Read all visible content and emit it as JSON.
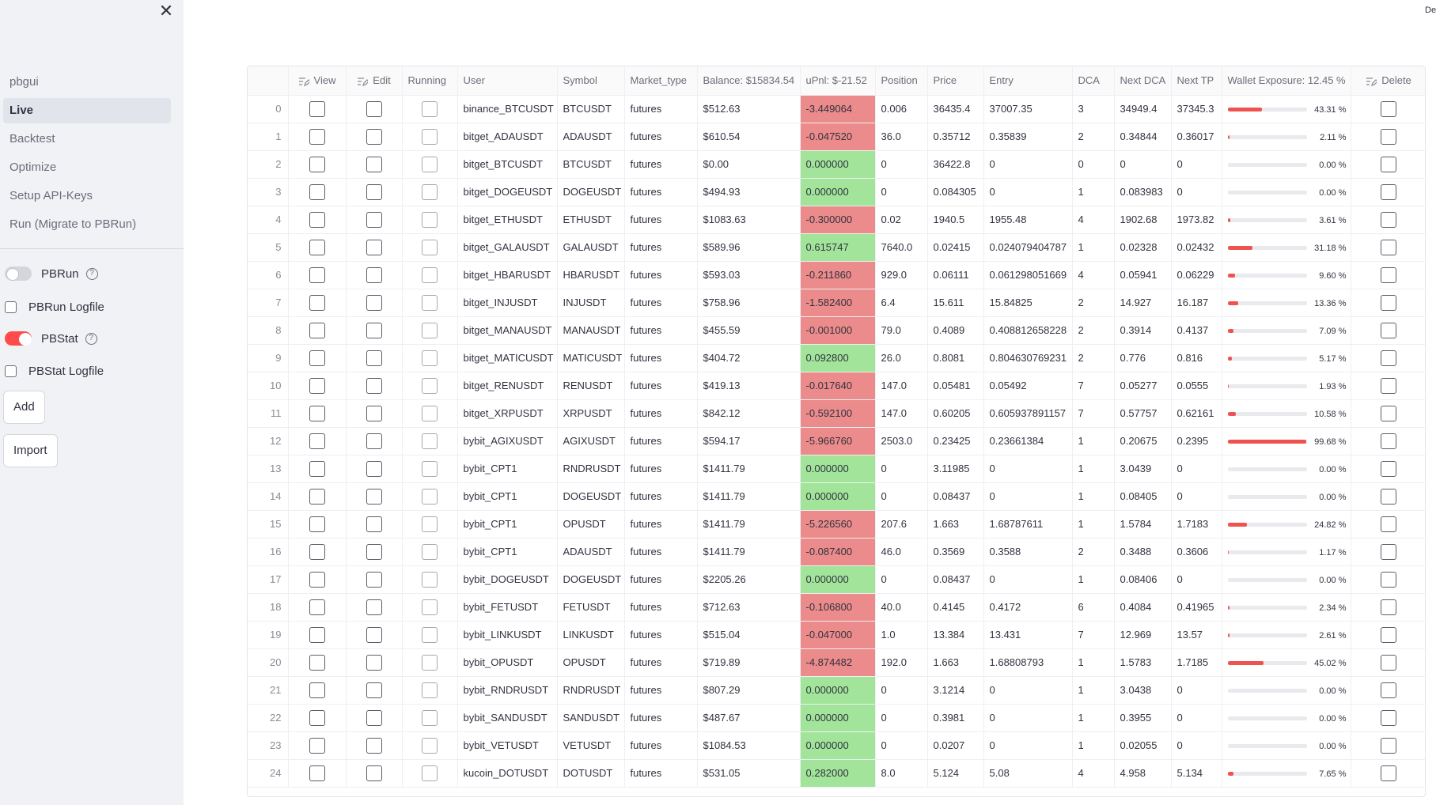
{
  "app": {
    "topright_text": "Deploy"
  },
  "sidebar": {
    "close_icon": "✕",
    "nav": [
      {
        "label": "pbgui",
        "active": false
      },
      {
        "label": "Live",
        "active": true
      },
      {
        "label": "Backtest",
        "active": false
      },
      {
        "label": "Optimize",
        "active": false
      },
      {
        "label": "Setup API-Keys",
        "active": false
      },
      {
        "label": "Run (Migrate to PBRun)",
        "active": false
      }
    ],
    "pbrun_toggle": {
      "label": "PBRun",
      "on": false
    },
    "pbrun_logfile": {
      "label": "PBRun Logfile",
      "checked": false
    },
    "pbstat_toggle": {
      "label": "PBStat",
      "on": true
    },
    "pbstat_logfile": {
      "label": "PBStat Logfile",
      "checked": false
    },
    "add_button": "Add",
    "import_button": "Import",
    "help_glyph": "?"
  },
  "table": {
    "columns": [
      "",
      "View",
      "Edit",
      "Running",
      "User",
      "Symbol",
      "Market_type",
      "Balance: $15834.54",
      "uPnl: $-21.52",
      "Position",
      "Price",
      "Entry",
      "DCA",
      "Next DCA",
      "Next TP",
      "Wallet Exposure: 12.45 %",
      "Delete"
    ],
    "colors": {
      "negative": "#ec8b8b",
      "positive": "#a2e59a",
      "bar": "#ef5350"
    },
    "rows": [
      {
        "idx": "0",
        "user": "binance_BTCUSDT",
        "symbol": "BTCUSDT",
        "market": "futures",
        "balance": "$512.63",
        "upnl": "-3.449064",
        "position": "0.006",
        "price": "36435.4",
        "entry": "37007.35",
        "dca": "3",
        "next_dca": "34949.4",
        "next_tp": "37345.3",
        "we": "43.31 %",
        "we_frac": 0.4331
      },
      {
        "idx": "1",
        "user": "bitget_ADAUSDT",
        "symbol": "ADAUSDT",
        "market": "futures",
        "balance": "$610.54",
        "upnl": "-0.047520",
        "position": "36.0",
        "price": "0.35712",
        "entry": "0.35839",
        "dca": "2",
        "next_dca": "0.34844",
        "next_tp": "0.36017",
        "we": "2.11 %",
        "we_frac": 0.0211
      },
      {
        "idx": "2",
        "user": "bitget_BTCUSDT",
        "symbol": "BTCUSDT",
        "market": "futures",
        "balance": "$0.00",
        "upnl": "0.000000",
        "position": "0",
        "price": "36422.8",
        "entry": "0",
        "dca": "0",
        "next_dca": "0",
        "next_tp": "0",
        "we": "0.00 %",
        "we_frac": 0
      },
      {
        "idx": "3",
        "user": "bitget_DOGEUSDT",
        "symbol": "DOGEUSDT",
        "market": "futures",
        "balance": "$494.93",
        "upnl": "0.000000",
        "position": "0",
        "price": "0.084305",
        "entry": "0",
        "dca": "1",
        "next_dca": "0.083983",
        "next_tp": "0",
        "we": "0.00 %",
        "we_frac": 0
      },
      {
        "idx": "4",
        "user": "bitget_ETHUSDT",
        "symbol": "ETHUSDT",
        "market": "futures",
        "balance": "$1083.63",
        "upnl": "-0.300000",
        "position": "0.02",
        "price": "1940.5",
        "entry": "1955.48",
        "dca": "4",
        "next_dca": "1902.68",
        "next_tp": "1973.82",
        "we": "3.61 %",
        "we_frac": 0.0361
      },
      {
        "idx": "5",
        "user": "bitget_GALAUSDT",
        "symbol": "GALAUSDT",
        "market": "futures",
        "balance": "$589.96",
        "upnl": "0.615747",
        "position": "7640.0",
        "price": "0.02415",
        "entry": "0.024079404787",
        "dca": "1",
        "next_dca": "0.02328",
        "next_tp": "0.02432",
        "we": "31.18 %",
        "we_frac": 0.3118
      },
      {
        "idx": "6",
        "user": "bitget_HBARUSDT",
        "symbol": "HBARUSDT",
        "market": "futures",
        "balance": "$593.03",
        "upnl": "-0.211860",
        "position": "929.0",
        "price": "0.06111",
        "entry": "0.061298051669",
        "dca": "4",
        "next_dca": "0.05941",
        "next_tp": "0.06229",
        "we": "9.60 %",
        "we_frac": 0.096
      },
      {
        "idx": "7",
        "user": "bitget_INJUSDT",
        "symbol": "INJUSDT",
        "market": "futures",
        "balance": "$758.96",
        "upnl": "-1.582400",
        "position": "6.4",
        "price": "15.611",
        "entry": "15.84825",
        "dca": "2",
        "next_dca": "14.927",
        "next_tp": "16.187",
        "we": "13.36 %",
        "we_frac": 0.1336
      },
      {
        "idx": "8",
        "user": "bitget_MANAUSDT",
        "symbol": "MANAUSDT",
        "market": "futures",
        "balance": "$455.59",
        "upnl": "-0.001000",
        "position": "79.0",
        "price": "0.4089",
        "entry": "0.408812658228",
        "dca": "2",
        "next_dca": "0.3914",
        "next_tp": "0.4137",
        "we": "7.09 %",
        "we_frac": 0.0709
      },
      {
        "idx": "9",
        "user": "bitget_MATICUSDT",
        "symbol": "MATICUSDT",
        "market": "futures",
        "balance": "$404.72",
        "upnl": "0.092800",
        "position": "26.0",
        "price": "0.8081",
        "entry": "0.804630769231",
        "dca": "2",
        "next_dca": "0.776",
        "next_tp": "0.816",
        "we": "5.17 %",
        "we_frac": 0.0517
      },
      {
        "idx": "10",
        "user": "bitget_RENUSDT",
        "symbol": "RENUSDT",
        "market": "futures",
        "balance": "$419.13",
        "upnl": "-0.017640",
        "position": "147.0",
        "price": "0.05481",
        "entry": "0.05492",
        "dca": "7",
        "next_dca": "0.05277",
        "next_tp": "0.0555",
        "we": "1.93 %",
        "we_frac": 0.0193
      },
      {
        "idx": "11",
        "user": "bitget_XRPUSDT",
        "symbol": "XRPUSDT",
        "market": "futures",
        "balance": "$842.12",
        "upnl": "-0.592100",
        "position": "147.0",
        "price": "0.60205",
        "entry": "0.605937891157",
        "dca": "7",
        "next_dca": "0.57757",
        "next_tp": "0.62161",
        "we": "10.58 %",
        "we_frac": 0.1058
      },
      {
        "idx": "12",
        "user": "bybit_AGIXUSDT",
        "symbol": "AGIXUSDT",
        "market": "futures",
        "balance": "$594.17",
        "upnl": "-5.966760",
        "position": "2503.0",
        "price": "0.23425",
        "entry": "0.23661384",
        "dca": "1",
        "next_dca": "0.20675",
        "next_tp": "0.2395",
        "we": "99.68 %",
        "we_frac": 0.9968
      },
      {
        "idx": "13",
        "user": "bybit_CPT1",
        "symbol": "RNDRUSDT",
        "market": "futures",
        "balance": "$1411.79",
        "upnl": "0.000000",
        "position": "0",
        "price": "3.11985",
        "entry": "0",
        "dca": "1",
        "next_dca": "3.0439",
        "next_tp": "0",
        "we": "0.00 %",
        "we_frac": 0
      },
      {
        "idx": "14",
        "user": "bybit_CPT1",
        "symbol": "DOGEUSDT",
        "market": "futures",
        "balance": "$1411.79",
        "upnl": "0.000000",
        "position": "0",
        "price": "0.08437",
        "entry": "0",
        "dca": "1",
        "next_dca": "0.08405",
        "next_tp": "0",
        "we": "0.00 %",
        "we_frac": 0
      },
      {
        "idx": "15",
        "user": "bybit_CPT1",
        "symbol": "OPUSDT",
        "market": "futures",
        "balance": "$1411.79",
        "upnl": "-5.226560",
        "position": "207.6",
        "price": "1.663",
        "entry": "1.68787611",
        "dca": "1",
        "next_dca": "1.5784",
        "next_tp": "1.7183",
        "we": "24.82 %",
        "we_frac": 0.2482
      },
      {
        "idx": "16",
        "user": "bybit_CPT1",
        "symbol": "ADAUSDT",
        "market": "futures",
        "balance": "$1411.79",
        "upnl": "-0.087400",
        "position": "46.0",
        "price": "0.3569",
        "entry": "0.3588",
        "dca": "2",
        "next_dca": "0.3488",
        "next_tp": "0.3606",
        "we": "1.17 %",
        "we_frac": 0.0117
      },
      {
        "idx": "17",
        "user": "bybit_DOGEUSDT",
        "symbol": "DOGEUSDT",
        "market": "futures",
        "balance": "$2205.26",
        "upnl": "0.000000",
        "position": "0",
        "price": "0.08437",
        "entry": "0",
        "dca": "1",
        "next_dca": "0.08406",
        "next_tp": "0",
        "we": "0.00 %",
        "we_frac": 0
      },
      {
        "idx": "18",
        "user": "bybit_FETUSDT",
        "symbol": "FETUSDT",
        "market": "futures",
        "balance": "$712.63",
        "upnl": "-0.106800",
        "position": "40.0",
        "price": "0.4145",
        "entry": "0.4172",
        "dca": "6",
        "next_dca": "0.4084",
        "next_tp": "0.41965",
        "we": "2.34 %",
        "we_frac": 0.0234
      },
      {
        "idx": "19",
        "user": "bybit_LINKUSDT",
        "symbol": "LINKUSDT",
        "market": "futures",
        "balance": "$515.04",
        "upnl": "-0.047000",
        "position": "1.0",
        "price": "13.384",
        "entry": "13.431",
        "dca": "7",
        "next_dca": "12.969",
        "next_tp": "13.57",
        "we": "2.61 %",
        "we_frac": 0.0261
      },
      {
        "idx": "20",
        "user": "bybit_OPUSDT",
        "symbol": "OPUSDT",
        "market": "futures",
        "balance": "$719.89",
        "upnl": "-4.874482",
        "position": "192.0",
        "price": "1.663",
        "entry": "1.68808793",
        "dca": "1",
        "next_dca": "1.5783",
        "next_tp": "1.7185",
        "we": "45.02 %",
        "we_frac": 0.4502
      },
      {
        "idx": "21",
        "user": "bybit_RNDRUSDT",
        "symbol": "RNDRUSDT",
        "market": "futures",
        "balance": "$807.29",
        "upnl": "0.000000",
        "position": "0",
        "price": "3.1214",
        "entry": "0",
        "dca": "1",
        "next_dca": "3.0438",
        "next_tp": "0",
        "we": "0.00 %",
        "we_frac": 0
      },
      {
        "idx": "22",
        "user": "bybit_SANDUSDT",
        "symbol": "SANDUSDT",
        "market": "futures",
        "balance": "$487.67",
        "upnl": "0.000000",
        "position": "0",
        "price": "0.3981",
        "entry": "0",
        "dca": "1",
        "next_dca": "0.3955",
        "next_tp": "0",
        "we": "0.00 %",
        "we_frac": 0
      },
      {
        "idx": "23",
        "user": "bybit_VETUSDT",
        "symbol": "VETUSDT",
        "market": "futures",
        "balance": "$1084.53",
        "upnl": "0.000000",
        "position": "0",
        "price": "0.0207",
        "entry": "0",
        "dca": "1",
        "next_dca": "0.02055",
        "next_tp": "0",
        "we": "0.00 %",
        "we_frac": 0
      },
      {
        "idx": "24",
        "user": "kucoin_DOTUSDT",
        "symbol": "DOTUSDT",
        "market": "futures",
        "balance": "$531.05",
        "upnl": "0.282000",
        "position": "8.0",
        "price": "5.124",
        "entry": "5.08",
        "dca": "4",
        "next_dca": "4.958",
        "next_tp": "5.134",
        "we": "7.65 %",
        "we_frac": 0.0765
      }
    ]
  }
}
